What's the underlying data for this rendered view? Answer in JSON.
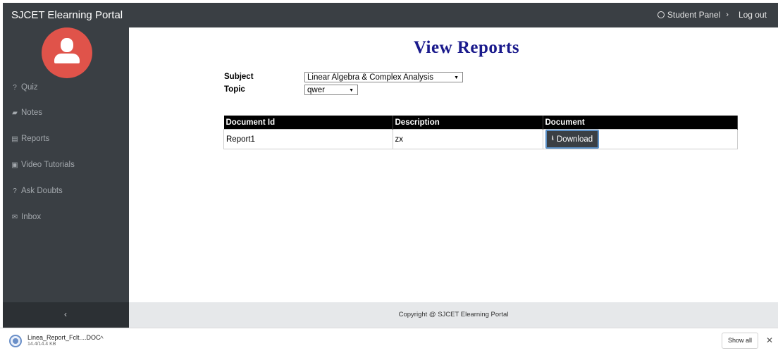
{
  "app": {
    "brand": "SJCET Elearning Portal",
    "nav": {
      "student_panel": "Student Panel",
      "chevron": "›",
      "logout": "Log out"
    }
  },
  "sidebar": {
    "items": [
      {
        "label": "Quiz",
        "icon": "question-circle-icon",
        "glyph": "?"
      },
      {
        "label": "Notes",
        "icon": "book-icon",
        "glyph": "▰"
      },
      {
        "label": "Reports",
        "icon": "file-icon",
        "glyph": "▤"
      },
      {
        "label": "Video Tutorials",
        "icon": "video-file-icon",
        "glyph": "▣"
      },
      {
        "label": "Ask Doubts",
        "icon": "question-circle-icon",
        "glyph": "?"
      },
      {
        "label": "Inbox",
        "icon": "envelope-icon",
        "glyph": "✉"
      }
    ],
    "collapse": "‹"
  },
  "main": {
    "title": "View Reports",
    "subject_label": "Subject",
    "subject_value": "Linear Algebra & Complex Analysis",
    "topic_label": "Topic",
    "topic_value": "qwer",
    "table": {
      "headers": [
        "Document Id",
        "Description",
        "Document"
      ],
      "rows": [
        {
          "id": "Report1",
          "description": "zx",
          "action": "Download"
        }
      ]
    }
  },
  "footer": {
    "text": "Copyright @ SJCET Elearning Portal"
  },
  "downloads_bar": {
    "file_name": "Linea_Report_Fclt....DOC",
    "file_size": "14.4/14.4 KB",
    "show_all": "Show all",
    "close": "✕",
    "chevron": "^"
  },
  "colors": {
    "nav_bg": "#3a3f44",
    "avatar": "#e0534a",
    "title": "#1a1a8c"
  }
}
